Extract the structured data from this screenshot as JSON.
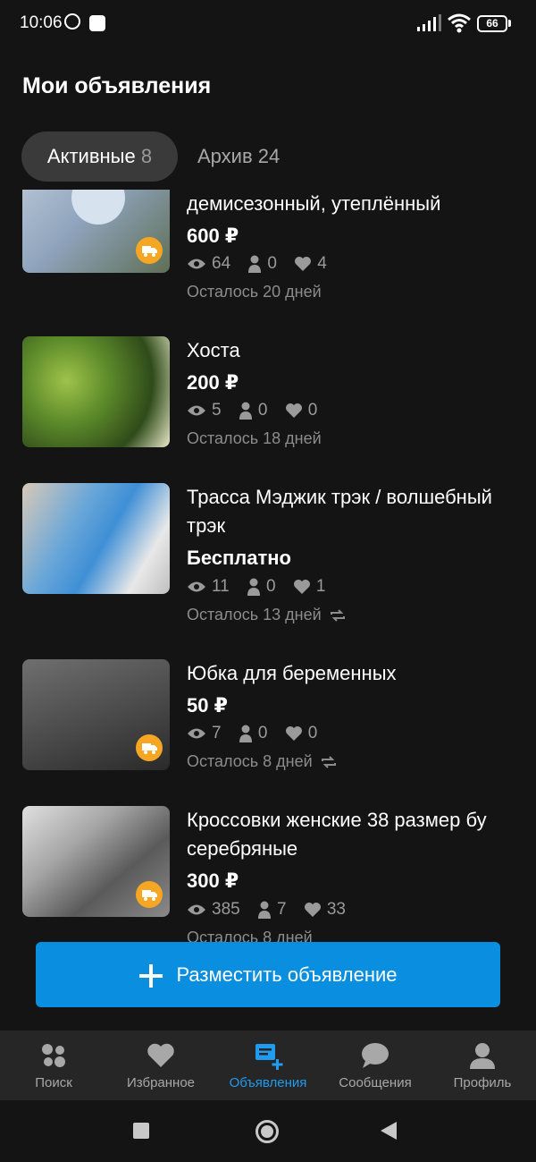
{
  "status_bar": {
    "time": "10:06",
    "battery": "66"
  },
  "header": {
    "title": "Мои объявления"
  },
  "tabs": [
    {
      "label": "Активные",
      "count": "8"
    },
    {
      "label": "Архив",
      "count": "24"
    }
  ],
  "listings": [
    {
      "title": "демисезонный, утеплённый",
      "price": "600 ₽",
      "views": "64",
      "contacts": "0",
      "favorites": "4",
      "remaining": "Осталось 20 дней",
      "delivery": true
    },
    {
      "title": "Хоста",
      "price": "200 ₽",
      "views": "5",
      "contacts": "0",
      "favorites": "0",
      "remaining": "Осталось 18 дней",
      "delivery": false
    },
    {
      "title": "Трасса Мэджик трэк / волшебный трэк",
      "price": "Бесплатно",
      "views": "11",
      "contacts": "0",
      "favorites": "1",
      "remaining": "Осталось 13 дней",
      "delivery": false
    },
    {
      "title": "Юбка для беременных",
      "price": "50 ₽",
      "views": "7",
      "contacts": "0",
      "favorites": "0",
      "remaining": "Осталось 8 дней",
      "delivery": true
    },
    {
      "title": "Кроссовки женские 38 размер бу серебряные",
      "price": "300 ₽",
      "views": "385",
      "contacts": "7",
      "favorites": "33",
      "remaining": "Осталось 8 дней",
      "delivery": true
    }
  ],
  "post_button": {
    "label": "Разместить объявление"
  },
  "bottom_nav": [
    {
      "label": "Поиск",
      "icon": "search-dots-icon"
    },
    {
      "label": "Избранное",
      "icon": "heart-icon"
    },
    {
      "label": "Объявления",
      "icon": "listings-add-icon",
      "active": true
    },
    {
      "label": "Сообщения",
      "icon": "chat-bubble-icon"
    },
    {
      "label": "Профиль",
      "icon": "profile-icon"
    }
  ],
  "colors": {
    "accent": "#0a8fe0",
    "nav_active": "#1f9bf0",
    "delivery_badge": "#f5a623",
    "background": "#141414"
  }
}
